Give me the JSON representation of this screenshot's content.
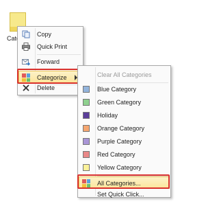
{
  "desktop": {
    "item_label": "Cate"
  },
  "context_menu": {
    "items": [
      {
        "label": "Copy",
        "icon": "copy-icon"
      },
      {
        "label": "Quick Print",
        "icon": "printer-icon"
      },
      {
        "label": "Forward",
        "icon": "forward-icon"
      },
      {
        "label": "Categorize",
        "icon": "categorize-icon"
      },
      {
        "label": "Delete",
        "icon": "delete-icon"
      }
    ]
  },
  "categorize_menu": {
    "clear_label": "Clear All Categories",
    "categories": [
      {
        "label": "Blue Category",
        "color": "#93b4dc"
      },
      {
        "label": "Green Category",
        "color": "#8fd18f"
      },
      {
        "label": "Holiday",
        "color": "#5b3e9a"
      },
      {
        "label": "Orange Category",
        "color": "#f5a670"
      },
      {
        "label": "Purple Category",
        "color": "#a995d6"
      },
      {
        "label": "Red Category",
        "color": "#e98888"
      },
      {
        "label": "Yellow Category",
        "color": "#fbf29a"
      }
    ],
    "all_categories_label": "All Categories...",
    "set_quick_click_label": "Set Quick Click..."
  },
  "colors": {
    "highlight_border": "#d9312b",
    "hover_fill": "#fbe59c"
  }
}
